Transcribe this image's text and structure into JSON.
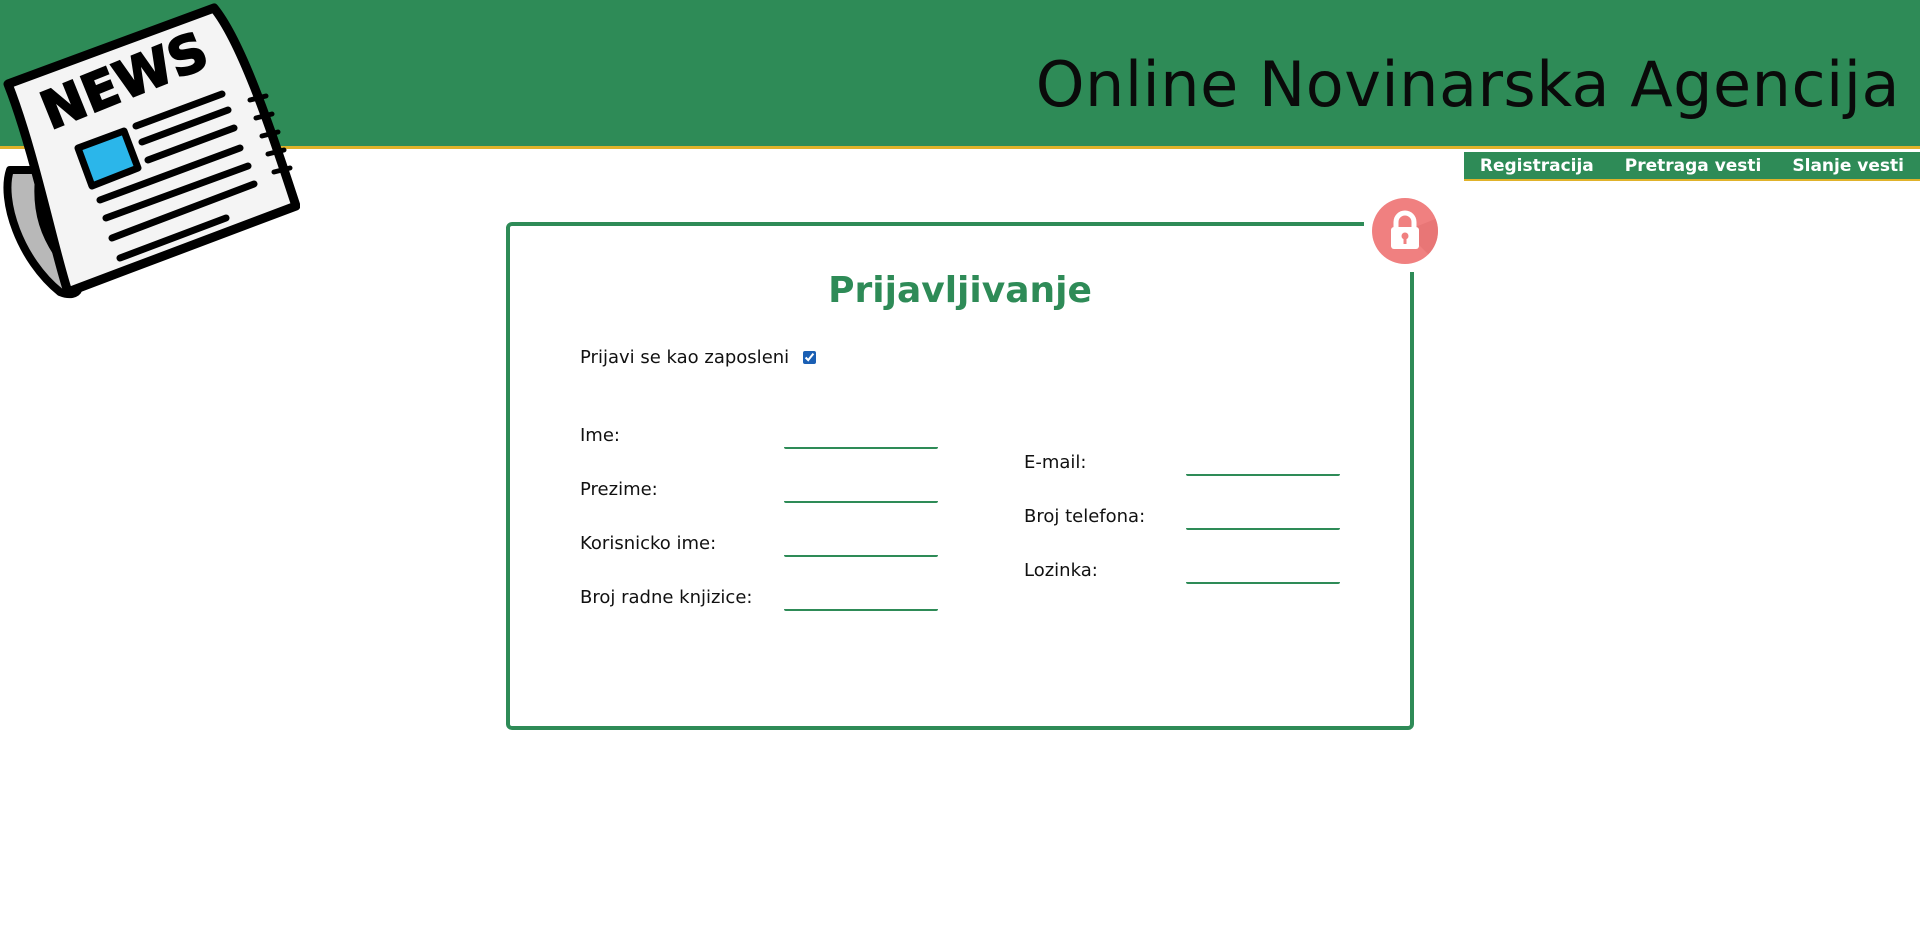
{
  "header": {
    "site_title": "Online Novinarska Agencija",
    "background_color": "#2e8b57",
    "accent_color": "#e0b22a"
  },
  "logo": {
    "text": "NEWS",
    "icon": "newspaper-icon"
  },
  "nav": {
    "items": [
      {
        "label": "Registracija"
      },
      {
        "label": "Pretraga vesti"
      },
      {
        "label": "Slanje vesti"
      }
    ]
  },
  "form": {
    "title": "Prijavljivanje",
    "lock_icon": "lock-icon",
    "lock_color": "#f08080",
    "employee_checkbox": {
      "label": "Prijavi se kao zaposleni",
      "checked": true
    },
    "left_fields": [
      {
        "label": "Ime:",
        "value": ""
      },
      {
        "label": "Prezime:",
        "value": ""
      },
      {
        "label": "Korisnicko ime:",
        "value": ""
      },
      {
        "label": "Broj radne knjizice:",
        "value": ""
      }
    ],
    "right_fields": [
      {
        "label": "E-mail:",
        "value": ""
      },
      {
        "label": "Broj telefona:",
        "value": ""
      },
      {
        "label": "Lozinka:",
        "value": ""
      }
    ]
  }
}
